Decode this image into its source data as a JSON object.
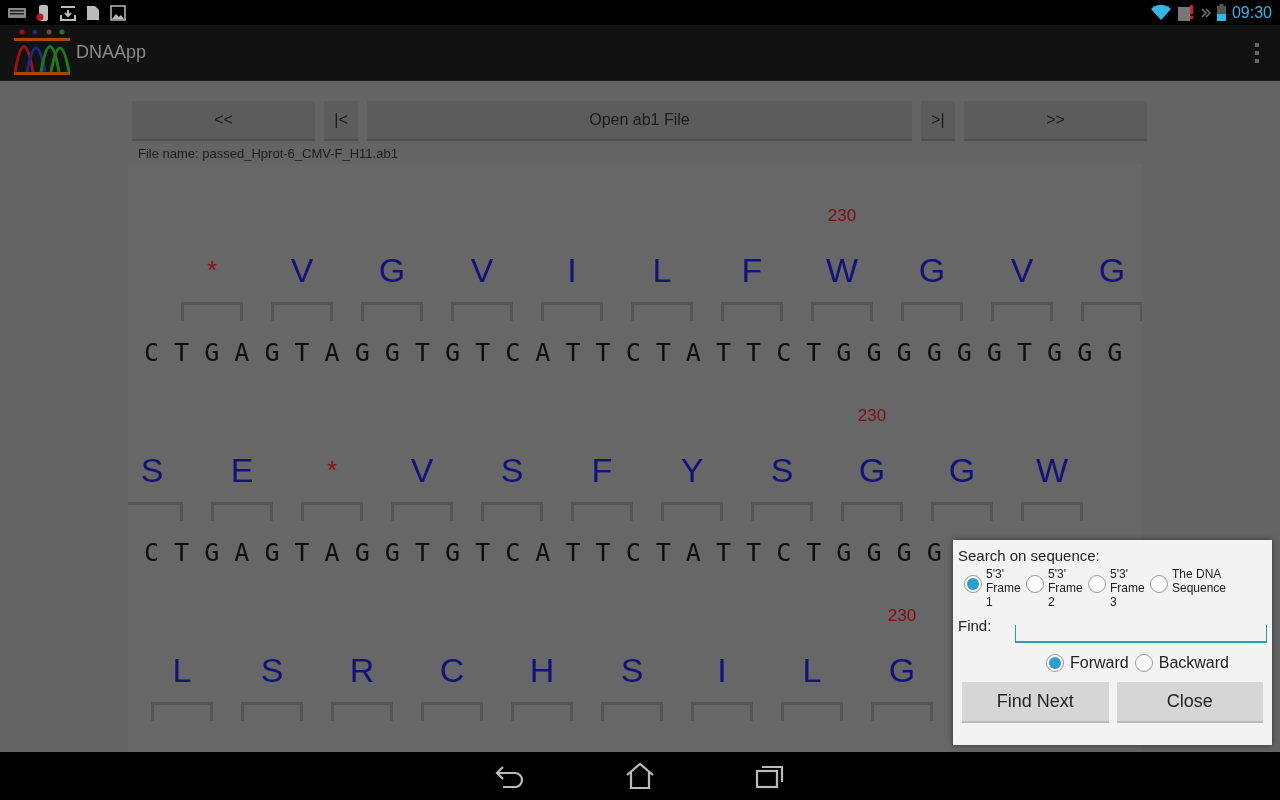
{
  "status_bar": {
    "time": "09:30"
  },
  "app_bar": {
    "title": "DNAApp"
  },
  "toolbar": [
    {
      "label": "<<"
    },
    {
      "label": "|<"
    },
    {
      "label": "Open ab1 File"
    },
    {
      "label": ">|"
    },
    {
      "label": ">>"
    }
  ],
  "file_name": "File name: passed_Hprot-6_CMV-F_H11.ab1",
  "tracks": [
    {
      "position_label": "230",
      "residues": [
        {
          "letter": "*",
          "kind": "stop"
        },
        {
          "letter": "V",
          "kind": "residue"
        },
        {
          "letter": "G",
          "kind": "residue"
        },
        {
          "letter": "V",
          "kind": "residue"
        },
        {
          "letter": "I",
          "kind": "residue"
        },
        {
          "letter": "L",
          "kind": "residue"
        },
        {
          "letter": "F",
          "kind": "residue"
        },
        {
          "letter": "W",
          "kind": "residue"
        },
        {
          "letter": "G",
          "kind": "residue"
        },
        {
          "letter": "V",
          "kind": "residue"
        },
        {
          "letter": "G",
          "kind": "residue"
        }
      ],
      "dna": "C T G A G T A G G T G T C A T T C T A T T C T G G G G G G T G G G"
    },
    {
      "position_label": "230",
      "residues": [
        {
          "letter": "S",
          "kind": "residue"
        },
        {
          "letter": "E",
          "kind": "residue"
        },
        {
          "letter": "*",
          "kind": "stop"
        },
        {
          "letter": "V",
          "kind": "residue"
        },
        {
          "letter": "S",
          "kind": "residue"
        },
        {
          "letter": "F",
          "kind": "residue"
        },
        {
          "letter": "Y",
          "kind": "residue"
        },
        {
          "letter": "S",
          "kind": "residue"
        },
        {
          "letter": "G",
          "kind": "residue"
        },
        {
          "letter": "G",
          "kind": "residue"
        },
        {
          "letter": "W",
          "kind": "residue"
        }
      ],
      "dna": "C T G A G T A G G T G T C A T T C T A T T C T G G G G"
    },
    {
      "position_label": "230",
      "residues": [
        {
          "letter": "L",
          "kind": "residue"
        },
        {
          "letter": "S",
          "kind": "residue"
        },
        {
          "letter": "R",
          "kind": "residue"
        },
        {
          "letter": "C",
          "kind": "residue"
        },
        {
          "letter": "H",
          "kind": "residue"
        },
        {
          "letter": "S",
          "kind": "residue"
        },
        {
          "letter": "I",
          "kind": "residue"
        },
        {
          "letter": "L",
          "kind": "residue"
        },
        {
          "letter": "G",
          "kind": "residue"
        }
      ]
    }
  ],
  "dialog": {
    "title": "Search on sequence:",
    "targets": [
      {
        "label": "5'3' Frame 1",
        "selected": true
      },
      {
        "label": "5'3' Frame 2",
        "selected": false
      },
      {
        "label": "5'3' Frame 3",
        "selected": false
      },
      {
        "label": "The DNA Sequence",
        "selected": false
      }
    ],
    "find_label": "Find:",
    "directions": [
      {
        "label": "Forward",
        "selected": true
      },
      {
        "label": "Backward",
        "selected": false
      }
    ],
    "buttons": [
      {
        "label": "Find Next"
      },
      {
        "label": "Close"
      }
    ]
  }
}
